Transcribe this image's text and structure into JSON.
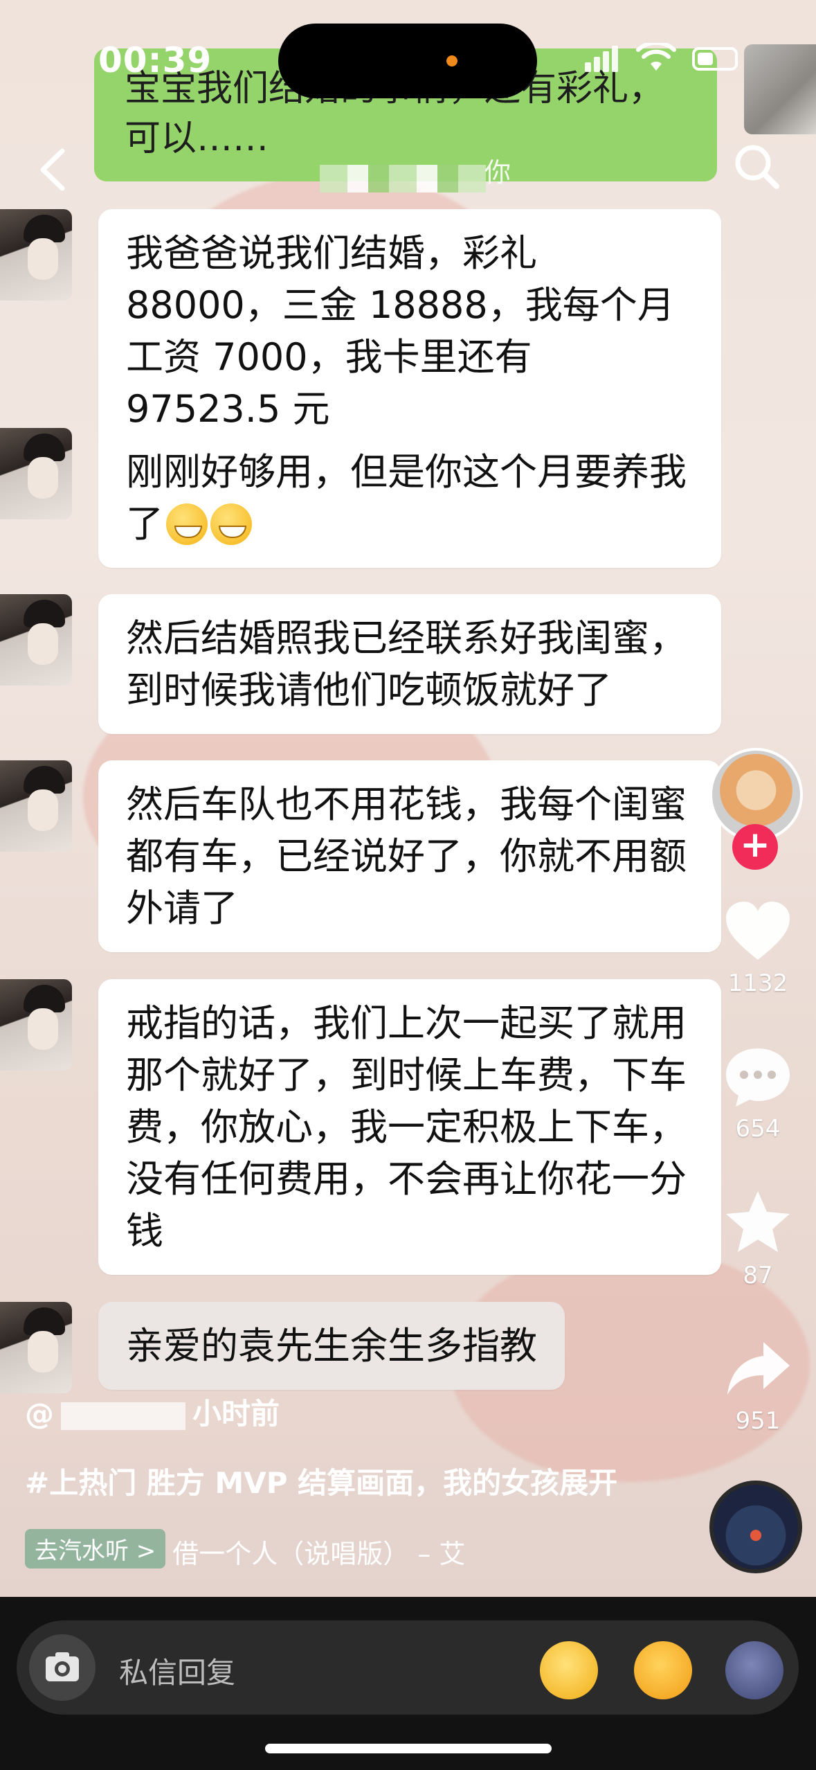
{
  "status_bar": {
    "time": "00:39"
  },
  "sent_message": {
    "text_line1": "宝宝我们结婚的事情，还有彩礼，",
    "text_line2": "可以……",
    "subtext": "你"
  },
  "messages": [
    {
      "text": "我爸爸说我们结婚，彩礼 88000，三金 18888，我每个月工资 7000，我卡里还有 97523.5 元"
    },
    {
      "text": "刚刚好够用，但是你这个月要养我了"
    },
    {
      "text": "然后结婚照我已经联系好我闺蜜，到时候我请他们吃顿饭就好了"
    },
    {
      "text": "然后车队也不用花钱，我每个闺蜜都有车，已经说好了，你就不用额外请了"
    },
    {
      "text": "戒指的话，我们上次一起买了就用那个就好了，到时候上车费，下车费，你放心，我一定积极上下车，没有任何费用，不会再让你花一分钱"
    },
    {
      "text": "亲爱的袁先生余生多指教"
    }
  ],
  "rail": {
    "follow_symbol": "+",
    "likes": "1132",
    "comments": "654",
    "favorites": "87",
    "shares": "951"
  },
  "post": {
    "username_prefix": "@",
    "time_ago": "小时前",
    "caption": "#上热门 胜方 MVP 结算画面，我的女孩",
    "expand_label": "展开",
    "music_tag": "去汽水听 >",
    "music_title": "借一个人（说唱版） – 艾"
  },
  "reply_bar": {
    "placeholder": "私信回复"
  },
  "colors": {
    "sent_bubble": "#95d46b",
    "received_bubble": "#ffffff",
    "follow_button": "#f22c58",
    "bottom_bar": "#121212"
  },
  "icons": [
    "back-icon",
    "search-icon",
    "heart-icon",
    "comment-icon",
    "star-icon",
    "share-icon",
    "camera-icon",
    "wifi-icon",
    "battery-icon"
  ]
}
